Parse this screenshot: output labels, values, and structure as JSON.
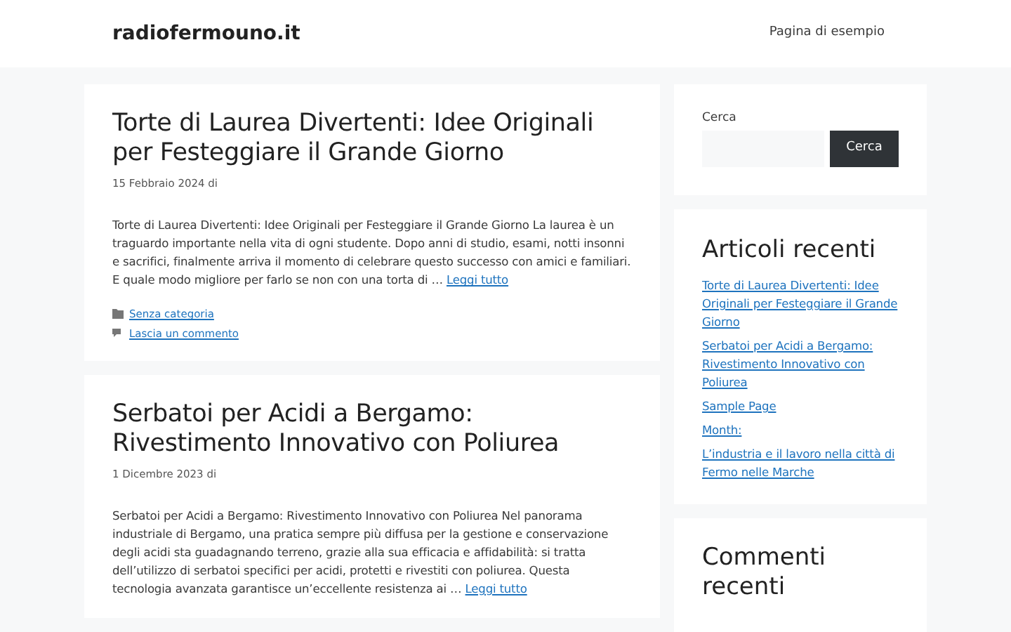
{
  "header": {
    "site_title": "radiofermouno.it",
    "nav": [
      {
        "label": "Pagina di esempio"
      }
    ]
  },
  "posts": [
    {
      "title": "Torte di Laurea Divertenti: Idee Originali per Festeggiare il Grande Giorno",
      "date": "15 Febbraio 2024 di",
      "excerpt": "Torte di Laurea Divertenti: Idee Originali per Festeggiare il Grande Giorno La laurea è un traguardo importante nella vita di ogni studente. Dopo anni di studio, esami, notti insonni e sacrifici, finalmente arriva il momento di celebrare questo successo con amici e familiari. E quale modo migliore per farlo se non con una torta di …",
      "read_more": "Leggi tutto",
      "category": "Senza categoria",
      "comment_link": "Lascia un commento"
    },
    {
      "title": "Serbatoi per Acidi a Bergamo: Rivestimento Innovativo con Poliurea",
      "date": "1 Dicembre 2023 di",
      "excerpt": "Serbatoi per Acidi a Bergamo: Rivestimento Innovativo con Poliurea Nel panorama industriale di Bergamo, una pratica sempre più diffusa per la gestione e conservazione degli acidi sta guadagnando terreno, grazie alla sua efficacia e affidabilità: si tratta dell’utilizzo di serbatoi specifici per acidi, protetti e rivestiti con poliurea. Questa tecnologia avanzata garantisce un’eccellente resistenza ai …",
      "read_more": "Leggi tutto"
    }
  ],
  "sidebar": {
    "search": {
      "label": "Cerca",
      "button": "Cerca"
    },
    "recent_posts": {
      "title": "Articoli recenti",
      "items": [
        "Torte di Laurea Divertenti: Idee Originali per Festeggiare il Grande Giorno",
        "Serbatoi per Acidi a Bergamo: Rivestimento Innovativo con Poliurea",
        "Sample Page",
        "Month:",
        "L’industria e il lavoro nella città di Fermo nelle Marche"
      ]
    },
    "recent_comments": {
      "title": "Commenti recenti"
    }
  }
}
